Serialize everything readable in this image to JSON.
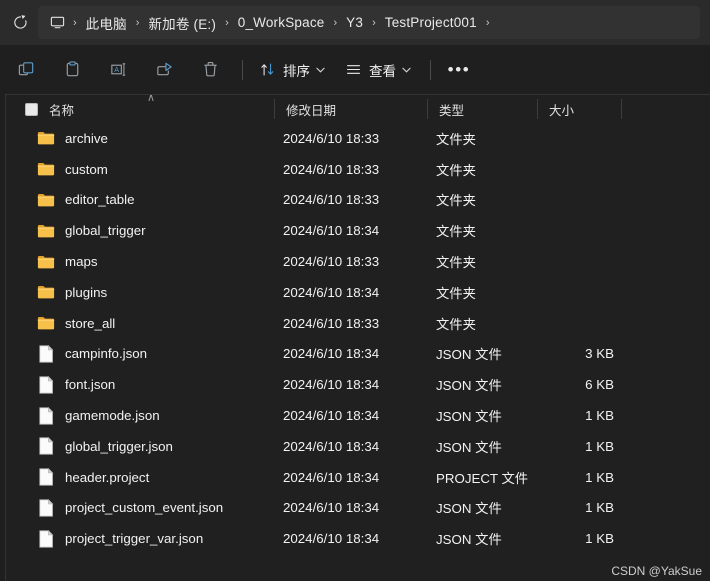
{
  "addressbar": {
    "refresh_icon": "refresh-icon",
    "pc_icon": "monitor-icon",
    "separator": "›",
    "crumbs": [
      {
        "label": "此电脑"
      },
      {
        "label": "新加卷 (E:)"
      },
      {
        "label": "0_WorkSpace"
      },
      {
        "label": "Y3"
      },
      {
        "label": "TestProject001"
      }
    ]
  },
  "toolbar": {
    "buttons": [
      {
        "name": "copy-button",
        "icon": "copy-icon"
      },
      {
        "name": "paste-button",
        "icon": "paste-icon"
      },
      {
        "name": "rename-button",
        "icon": "rename-icon"
      },
      {
        "name": "share-button",
        "icon": "share-icon"
      },
      {
        "name": "delete-button",
        "icon": "trash-icon"
      }
    ],
    "sort_label": "排序",
    "view_label": "查看",
    "chevron": "⌄",
    "more_label": "•••"
  },
  "columns": {
    "name": "名称",
    "date_modified": "修改日期",
    "type": "类型",
    "size": "大小",
    "sort_indicator": "∧"
  },
  "rows": [
    {
      "name": "archive",
      "icon": "folder-icon",
      "date": "2024/6/10 18:33",
      "type": "文件夹",
      "size": ""
    },
    {
      "name": "custom",
      "icon": "folder-icon",
      "date": "2024/6/10 18:33",
      "type": "文件夹",
      "size": ""
    },
    {
      "name": "editor_table",
      "icon": "folder-icon",
      "date": "2024/6/10 18:33",
      "type": "文件夹",
      "size": ""
    },
    {
      "name": "global_trigger",
      "icon": "folder-icon",
      "date": "2024/6/10 18:34",
      "type": "文件夹",
      "size": ""
    },
    {
      "name": "maps",
      "icon": "folder-icon",
      "date": "2024/6/10 18:33",
      "type": "文件夹",
      "size": ""
    },
    {
      "name": "plugins",
      "icon": "folder-icon",
      "date": "2024/6/10 18:34",
      "type": "文件夹",
      "size": ""
    },
    {
      "name": "store_all",
      "icon": "folder-icon",
      "date": "2024/6/10 18:33",
      "type": "文件夹",
      "size": ""
    },
    {
      "name": "campinfo.json",
      "icon": "document-icon",
      "date": "2024/6/10 18:34",
      "type": "JSON 文件",
      "size": "3 KB"
    },
    {
      "name": "font.json",
      "icon": "document-icon",
      "date": "2024/6/10 18:34",
      "type": "JSON 文件",
      "size": "6 KB"
    },
    {
      "name": "gamemode.json",
      "icon": "document-icon",
      "date": "2024/6/10 18:34",
      "type": "JSON 文件",
      "size": "1 KB"
    },
    {
      "name": "global_trigger.json",
      "icon": "document-icon",
      "date": "2024/6/10 18:34",
      "type": "JSON 文件",
      "size": "1 KB"
    },
    {
      "name": "header.project",
      "icon": "document-icon",
      "date": "2024/6/10 18:34",
      "type": "PROJECT 文件",
      "size": "1 KB"
    },
    {
      "name": "project_custom_event.json",
      "icon": "document-icon",
      "date": "2024/6/10 18:34",
      "type": "JSON 文件",
      "size": "1 KB"
    },
    {
      "name": "project_trigger_var.json",
      "icon": "document-icon",
      "date": "2024/6/10 18:34",
      "type": "JSON 文件",
      "size": "1 KB"
    }
  ],
  "watermark": "CSDN @YakSue",
  "colors": {
    "window_bg": "#1f1f1f",
    "addressbar_bg": "#2b2b2b",
    "addressfield_bg": "#323232",
    "pane_bg": "#202020",
    "folder": "#f7c04a",
    "accent": "#4a9ad4",
    "text": "#f2f2f2"
  }
}
